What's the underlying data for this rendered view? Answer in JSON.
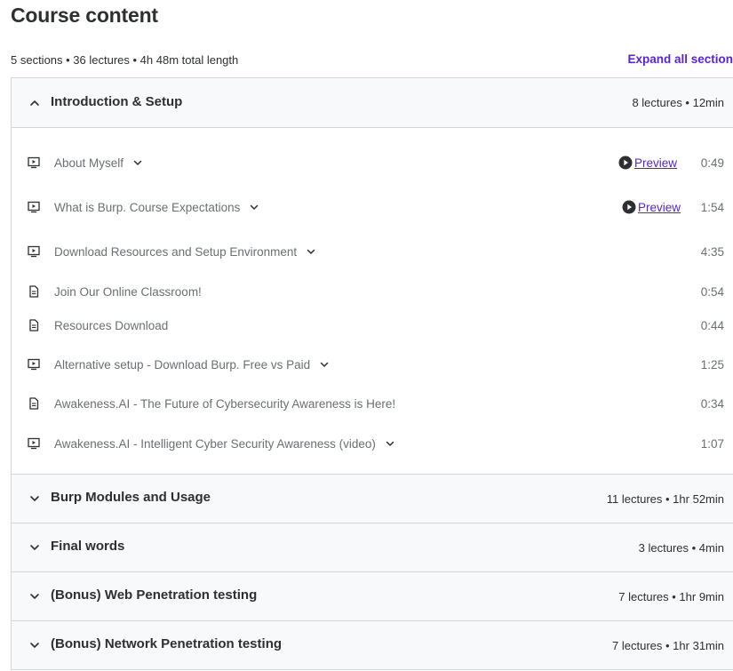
{
  "header": {
    "title": "Course content",
    "summary": "5 sections • 36 lectures • 4h 48m total length",
    "expand_all_label": "Expand all section"
  },
  "sections": [
    {
      "title": "Introduction & Setup",
      "meta": "8 lectures • 12min",
      "expanded": true,
      "lectures": [
        {
          "title": "About Myself",
          "type": "video",
          "expandable": true,
          "preview": "Preview",
          "duration": "0:49"
        },
        {
          "title": "What is Burp. Course Expectations",
          "type": "video",
          "expandable": true,
          "preview": "Preview",
          "duration": "1:54"
        },
        {
          "title": "Download Resources and Setup Environment",
          "type": "video",
          "expandable": true,
          "duration": "4:35"
        },
        {
          "title": "Join Our Online Classroom!",
          "type": "article",
          "expandable": false,
          "duration": "0:54"
        },
        {
          "title": "Resources Download",
          "type": "article",
          "expandable": false,
          "duration": "0:44"
        },
        {
          "title": "Alternative setup - Download Burp. Free vs Paid",
          "type": "video",
          "expandable": true,
          "duration": "1:25"
        },
        {
          "title": "Awakeness.AI - The Future of Cybersecurity Awareness is Here!",
          "type": "article",
          "expandable": false,
          "duration": "0:34"
        },
        {
          "title": "Awakeness.AI - Intelligent Cyber Security Awareness (video)",
          "type": "video",
          "expandable": true,
          "duration": "1:07"
        }
      ]
    },
    {
      "title": "Burp Modules and Usage",
      "meta": "11 lectures • 1hr 52min",
      "expanded": false
    },
    {
      "title": "Final words",
      "meta": "3 lectures • 4min",
      "expanded": false
    },
    {
      "title": "(Bonus) Web Penetration testing",
      "meta": "7 lectures • 1hr 9min",
      "expanded": false
    },
    {
      "title": "(Bonus) Network Penetration testing",
      "meta": "7 lectures • 1hr 31min",
      "expanded": false
    }
  ],
  "icons": {
    "chevron_up": "chevron-up-icon",
    "chevron_down": "chevron-down-icon",
    "video": "video-icon",
    "article": "file-icon",
    "play": "play-icon"
  },
  "colors": {
    "accent": "#5624d0",
    "text": "#2d2f31",
    "muted": "#6a6f73",
    "border": "#d1d7dc",
    "section_bg": "#f7f9fa"
  }
}
